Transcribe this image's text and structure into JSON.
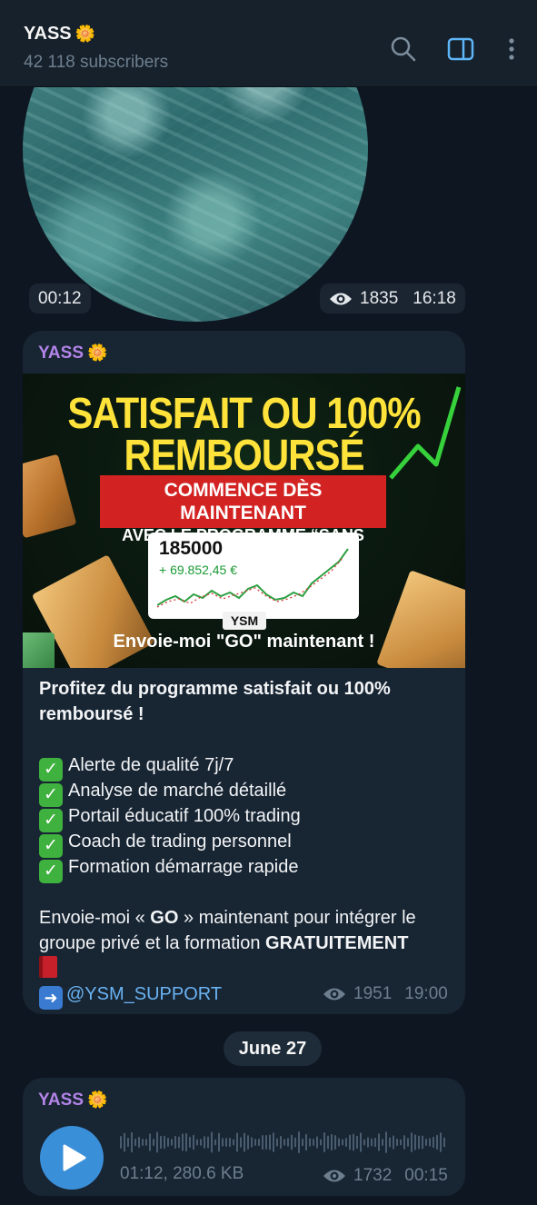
{
  "header": {
    "title": "YASS",
    "subtitle": "42 118 subscribers",
    "icons": [
      "search-icon",
      "sidebar-toggle-icon",
      "more-vertical-icon"
    ]
  },
  "video_message": {
    "duration": "00:12",
    "views": "1835",
    "time": "16:18"
  },
  "post": {
    "sender": "YASS",
    "image": {
      "headline_1": "SATISFAIT OU 100%",
      "headline_2": "REMBOURSÉ",
      "red_line_1": "COMMENCE DÈS MAINTENANT",
      "red_line_2": "AVEC LE PROGRAMME “SANS RISQUE”",
      "card_value": "185000",
      "card_change": "+ 69.852,45 €",
      "brand": "YSM",
      "cta": "Envoie-moi \"GO\" maintenant !"
    },
    "title_line_1": "Profitez du programme satisfait ou 100%",
    "title_line_2": "remboursé !",
    "features": [
      "Alerte de qualité 7j/7",
      "Analyse de marché détaillé",
      "Portail éducatif 100% trading",
      "Coach de trading personnel",
      "Formation démarrage rapide"
    ],
    "outro_1_a": "Envoie-moi « ",
    "outro_1_b": "GO",
    "outro_1_c": " » maintenant pour intégrer le",
    "outro_2_a": "groupe privé et la formation ",
    "outro_2_b": "GRATUITEMENT",
    "link": "@YSM_SUPPORT",
    "views": "1951",
    "time": "19:00"
  },
  "date_separator": "June 27",
  "audio_post": {
    "sender": "YASS",
    "info": "01:12, 280.6 KB",
    "views": "1732",
    "time": "00:15"
  }
}
